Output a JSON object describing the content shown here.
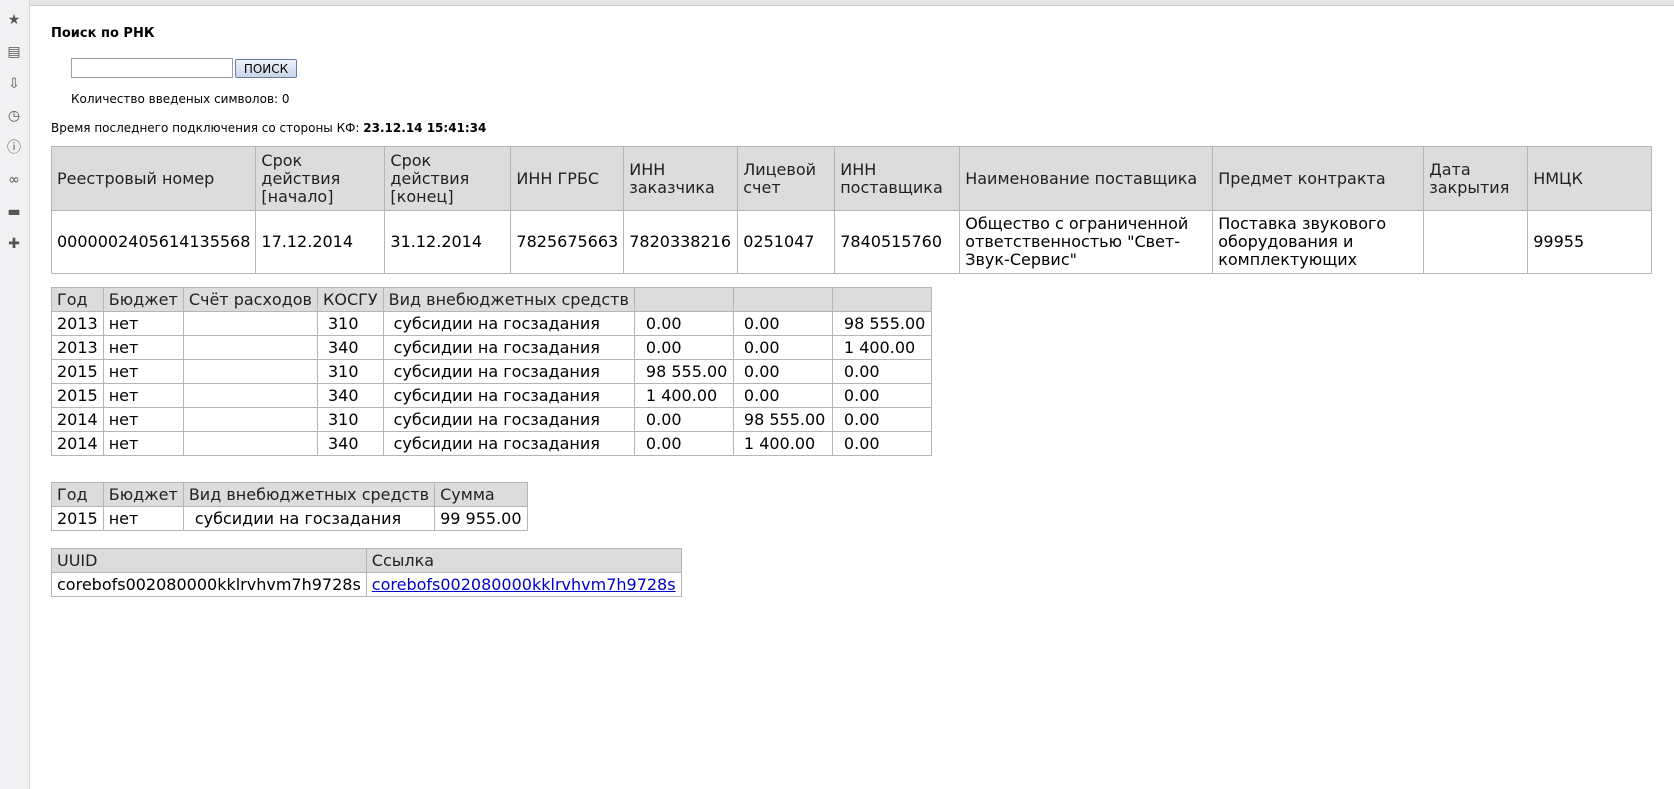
{
  "sidebar": {
    "icons": [
      "star-icon",
      "notes-icon",
      "inbox-icon",
      "clock-icon",
      "info-icon",
      "link-icon",
      "card-icon",
      "plus-icon"
    ]
  },
  "search": {
    "title": "Поиск по РНК",
    "input_value": "",
    "button_label": "ПОИСК",
    "char_count_text": "Количество введеных символов: 0"
  },
  "connection": {
    "label": "Время последнего подключения со стороны КФ:",
    "value": "23.12.14 15:41:34"
  },
  "main_table": {
    "headers": [
      "Реестровый номер",
      "Срок действия [начало]",
      "Срок действия [конец]",
      "ИНН ГРБС",
      "ИНН заказчика",
      "Лицевой счет",
      "ИНН поставщика",
      "Наименование поставщика",
      "Предмет контракта",
      "Дата закрытия",
      "НМЦК"
    ],
    "row": [
      "0000002405614135568",
      "17.12.2014",
      "31.12.2014",
      "7825675663",
      "7820338216",
      "0251047",
      "7840515760",
      "Общество с ограниченной ответственностью \"Свет-Звук-Сервис\"",
      "Поставка звукового оборудования и комплектующих",
      "",
      "99955"
    ]
  },
  "budget_table": {
    "headers": [
      "Год",
      "Бюджет",
      "Счёт расходов",
      "КОСГУ",
      "Вид внебюджетных средств",
      "",
      "",
      ""
    ],
    "rows": [
      [
        "2013",
        "нет",
        "",
        "310",
        "субсидии на госзадания",
        "0.00",
        "0.00",
        "98 555.00"
      ],
      [
        "2013",
        "нет",
        "",
        "340",
        "субсидии на госзадания",
        "0.00",
        "0.00",
        "1 400.00"
      ],
      [
        "2015",
        "нет",
        "",
        "310",
        "субсидии на госзадания",
        "98 555.00",
        "0.00",
        "0.00"
      ],
      [
        "2015",
        "нет",
        "",
        "340",
        "субсидии на госзадания",
        "1 400.00",
        "0.00",
        "0.00"
      ],
      [
        "2014",
        "нет",
        "",
        "310",
        "субсидии на госзадания",
        "0.00",
        "98 555.00",
        "0.00"
      ],
      [
        "2014",
        "нет",
        "",
        "340",
        "субсидии на госзадания",
        "0.00",
        "1 400.00",
        "0.00"
      ]
    ]
  },
  "sum_table": {
    "headers": [
      "Год",
      "Бюджет",
      "Вид внебюджетных средств",
      "Сумма"
    ],
    "rows": [
      [
        "2015",
        "нет",
        "субсидии на госзадания",
        "99 955.00"
      ]
    ]
  },
  "uuid_table": {
    "headers": [
      "UUID",
      "Ссылка"
    ],
    "rows": [
      [
        "corebofs002080000kklrvhvm7h9728s",
        "corebofs002080000kklrvhvm7h9728s"
      ]
    ]
  }
}
